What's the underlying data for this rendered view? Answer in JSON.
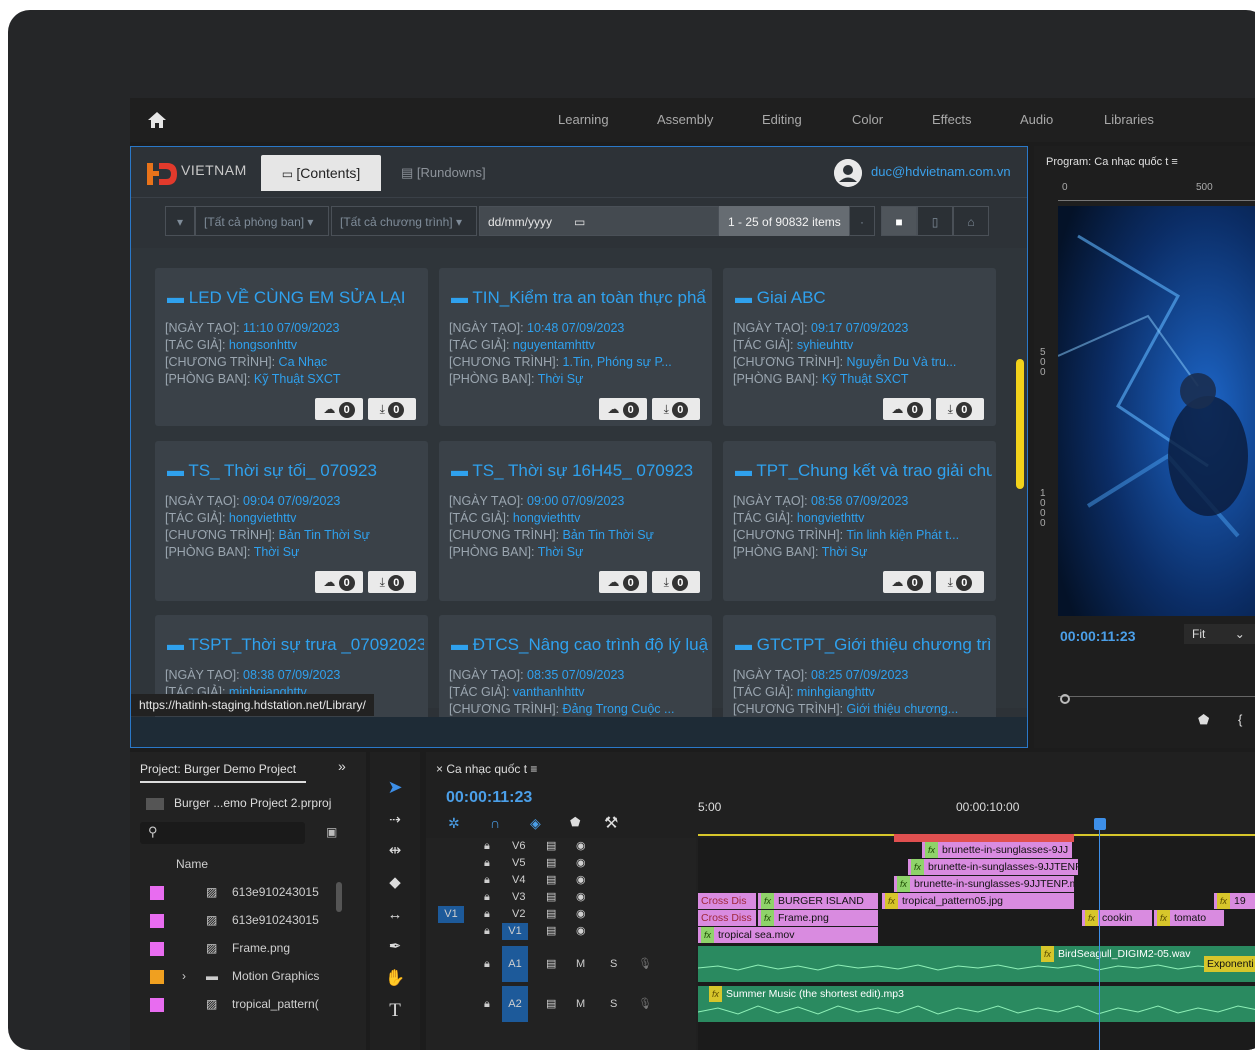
{
  "workspace": {
    "tabs": [
      "Learning",
      "Assembly",
      "Editing",
      "Color",
      "Effects",
      "Audio",
      "Libraries"
    ]
  },
  "library": {
    "logo_text": "VIETNAM",
    "tab_contents": "[Contents]",
    "tab_rundowns": "[Rundowns]",
    "user_email": "duc@hdvietnam.com.vn",
    "filter_department": "[Tất cả phòng ban]",
    "filter_program": "[Tất cả chương trình]",
    "date_placeholder": "dd/mm/yyyy",
    "item_count": "1 - 25 of 90832 items",
    "status_url": "https://hatinh-staging.hdstation.net/Library/",
    "labels": {
      "created": "[NGÀY TẠO]:",
      "author": "[TÁC GIẢ]:",
      "program": "[CHƯƠNG TRÌNH]:",
      "department": "[PHÒNG BAN]:"
    },
    "cards": [
      {
        "title": "LED VỀ CÙNG EM SỬA LẠI",
        "created": "11:10 07/09/2023",
        "author": "hongsonhttv",
        "program": "Ca Nhạc",
        "department": "Kỹ Thuật SXCT",
        "cloud": "0",
        "download": "0"
      },
      {
        "title": "TIN_Kiểm tra an toàn thực phẩ",
        "created": "10:48 07/09/2023",
        "author": "nguyentamhttv",
        "program": "1.Tin, Phóng sự P...",
        "department": "Thời Sự",
        "cloud": "0",
        "download": "0"
      },
      {
        "title": "Giai ABC",
        "created": "09:17 07/09/2023",
        "author": "syhieuhttv",
        "program": "Nguyễn Du Và tru...",
        "department": "Kỹ Thuật SXCT",
        "cloud": "0",
        "download": "0"
      },
      {
        "title": "TS_ Thời sự tối_ 070923",
        "created": "09:04 07/09/2023",
        "author": "hongviethttv",
        "program": "Bản Tin Thời Sự",
        "department": "Thời Sự",
        "cloud": "0",
        "download": "0"
      },
      {
        "title": "TS_ Thời sự 16H45_ 070923",
        "created": "09:00 07/09/2023",
        "author": "hongviethttv",
        "program": "Bản Tin Thời Sự",
        "department": "Thời Sự",
        "cloud": "0",
        "download": "0"
      },
      {
        "title": "TPT_Chung kết và trao giải chu",
        "created": "08:58 07/09/2023",
        "author": "hongviethttv",
        "program": "Tin linh kiện Phát t...",
        "department": "Thời Sự",
        "cloud": "0",
        "download": "0"
      },
      {
        "title": "TSPT_Thời sự trưa _07092023",
        "created": "08:38 07/09/2023",
        "author": "minhgianghttv",
        "program": "",
        "department": "",
        "cloud": "",
        "download": ""
      },
      {
        "title": "ĐTCS_Nâng cao trình độ lý luậ",
        "created": "08:35 07/09/2023",
        "author": "vanthanhhttv",
        "program": "Đảng Trong Cuộc ...",
        "department": "",
        "cloud": "",
        "download": ""
      },
      {
        "title": "GTCTPT_Giới thiệu chương trìn",
        "created": "08:25 07/09/2023",
        "author": "minhgianghttv",
        "program": "Giới thiệu chương...",
        "department": "",
        "cloud": "",
        "download": ""
      }
    ]
  },
  "program_monitor": {
    "title": "Program: Ca nhạc quốc t ≡",
    "ruler_0": "0",
    "ruler_500": "500",
    "vruler_a": "5\n0\n0",
    "vruler_b": "1\n0\n0\n0",
    "timecode": "00:00:11:23",
    "fit": "Fit"
  },
  "project": {
    "title": "Project: Burger Demo Project",
    "file": "Burger ...emo Project 2.prproj",
    "column_name": "Name",
    "items": [
      {
        "name": "613e910243015",
        "color": "#e86cf0"
      },
      {
        "name": "613e910243015",
        "color": "#e86cf0"
      },
      {
        "name": "Frame.png",
        "color": "#e86cf0"
      },
      {
        "name": "Motion Graphics",
        "color": "#f0a020"
      },
      {
        "name": "tropical_pattern(",
        "color": "#e86cf0"
      }
    ]
  },
  "timeline": {
    "tab": "Ca nhạc quốc t ≡",
    "timecode": "00:00:11:23",
    "time_a": "5:00",
    "time_b": "00:00:10:00",
    "video_tracks": [
      "V6",
      "V5",
      "V4",
      "V3",
      "V2",
      "V1"
    ],
    "audio_tracks": [
      "A1",
      "A2"
    ],
    "source_track": "V1",
    "m": "M",
    "s": "S",
    "clips": {
      "brunette1": "brunette-in-sunglasses-9JJ",
      "brunette2": "brunette-in-sunglasses-9JJTENP",
      "brunette3": "brunette-in-sunglasses-9JJTENP.m",
      "burger": "BURGER ISLAND",
      "tropical_pattern": "tropical_pattern05.jpg",
      "frame": "Frame.png",
      "tropical_sea": "tropical sea.mov",
      "cross1": "Cross Dis",
      "cross2": "Cross Diss",
      "cookin": "cookin",
      "tomato": "tomato",
      "nineteen": "19",
      "bird": "BirdSeagull_DIGIM2-05.wav",
      "exponential": "Exponenti",
      "summer": "Summer Music (the shortest edit).mp3"
    }
  }
}
